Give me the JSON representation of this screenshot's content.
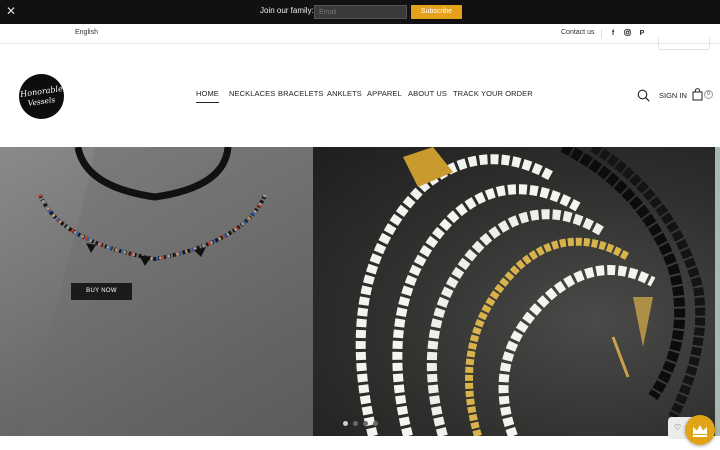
{
  "announcement": {
    "close_icon": "close-icon",
    "join_text": "Join our family:",
    "email_placeholder": "Email",
    "subscribe_label": "Subscribe"
  },
  "utility": {
    "language": "English",
    "contact": "Contact us",
    "social_icons": [
      "facebook-icon",
      "instagram-icon",
      "pinterest-icon"
    ]
  },
  "brand": {
    "logo_line1": "Honorable",
    "logo_line2": "Vessels"
  },
  "nav": {
    "items": [
      "HOME",
      "NECKLACES",
      "BRACELETS",
      "ANKLETS",
      "APPAREL",
      "ABOUT US",
      "TRACK YOUR ORDER"
    ],
    "active": "HOME"
  },
  "header_actions": {
    "signin": "SIGN IN",
    "cart_count": "0"
  },
  "hero": {
    "buy_now": "BUY NOW",
    "slide_count": 4,
    "active_slide": 1
  },
  "colors": {
    "announce_bg": "#111111",
    "subscribe_bg": "#e6a11a",
    "rewards_bg": "#e2a417"
  }
}
